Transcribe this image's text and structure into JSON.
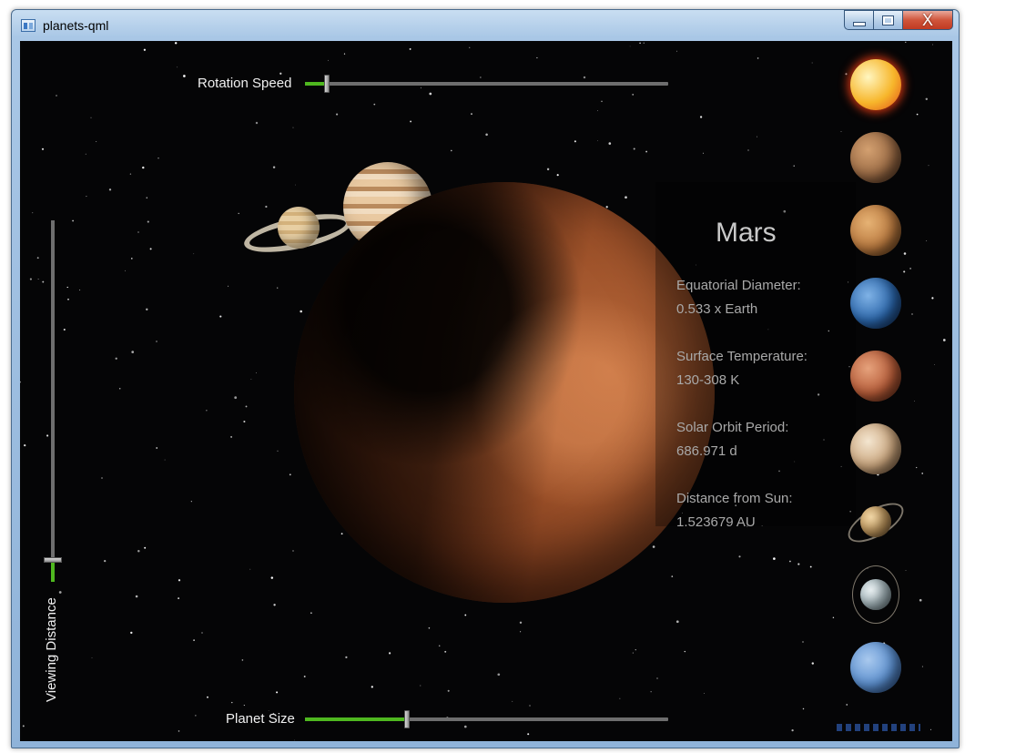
{
  "window": {
    "title": "planets-qml",
    "icon": "app-window-icon",
    "controls": {
      "close_glyph": "X"
    }
  },
  "sliders": {
    "rotation_speed": {
      "label": "Rotation Speed",
      "value_fraction": 0.06
    },
    "planet_size": {
      "label": "Planet Size",
      "value_fraction": 0.28
    },
    "viewing_distance": {
      "label": "Viewing Distance",
      "value_fraction": 0.06
    }
  },
  "info": {
    "planet_name": "Mars",
    "equatorial_diameter_label": "Equatorial Diameter:",
    "equatorial_diameter_value": "0.533 x Earth",
    "surface_temperature_label": "Surface Temperature:",
    "surface_temperature_value": "130-308 K",
    "solar_orbit_period_label": "Solar Orbit Period:",
    "solar_orbit_period_value": "686.971 d",
    "distance_from_sun_label": "Distance from Sun:",
    "distance_from_sun_value": "1.523679 AU"
  },
  "planet_selector": [
    {
      "name": "sun",
      "colors": [
        "#fff6c0",
        "#f7b62b",
        "#e04b16"
      ]
    },
    {
      "name": "mercury",
      "colors": [
        "#d3a070",
        "#9b6b45",
        "#4f3320"
      ]
    },
    {
      "name": "venus",
      "colors": [
        "#e6b274",
        "#b9793f",
        "#5e3a18"
      ]
    },
    {
      "name": "earth",
      "colors": [
        "#7fb2e6",
        "#2b66aa",
        "#0e2a55"
      ]
    },
    {
      "name": "mars",
      "colors": [
        "#e6a27c",
        "#b55b38",
        "#5a2613"
      ]
    },
    {
      "name": "jupiter",
      "colors": [
        "#f4e6d0",
        "#c9a47c",
        "#6c5035"
      ]
    },
    {
      "name": "saturn",
      "colors": [
        "#f0d6a6",
        "#c49a5e",
        "#5d452a"
      ]
    },
    {
      "name": "uranus",
      "colors": [
        "#e8eef0",
        "#a9bcc2",
        "#56666b"
      ]
    },
    {
      "name": "neptune",
      "colors": [
        "#a9c9ee",
        "#5b8fcf",
        "#23457a"
      ]
    }
  ]
}
